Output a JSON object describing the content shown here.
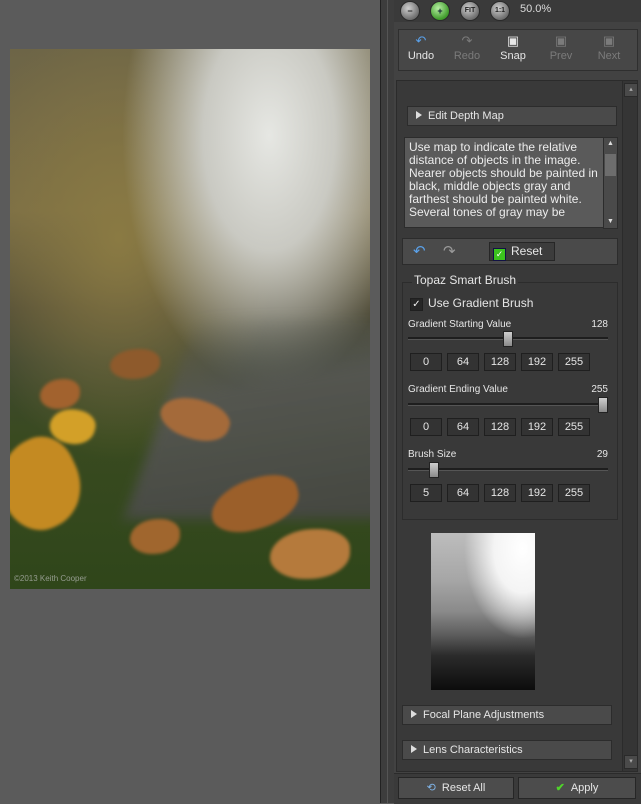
{
  "zoom": {
    "level": "50.0%",
    "buttons": [
      "minus-icon",
      "plus-icon",
      "fit",
      "1:1"
    ],
    "fit_label": "FIT",
    "actual_label": "1:1"
  },
  "toolbar": {
    "undo": "Undo",
    "redo": "Redo",
    "snap": "Snap",
    "prev": "Prev",
    "next": "Next"
  },
  "sections": {
    "edit_depth_map": "Edit Depth Map",
    "focal_plane": "Focal Plane Adjustments",
    "lens": "Lens Characteristics"
  },
  "description": "Use map to indicate the relative distance of objects in the image. Nearer objects should be painted in black, middle objects gray and farthest should be painted white. Several tones of gray may be",
  "mini_tools": {
    "reset": "Reset"
  },
  "smart_brush": {
    "title": "Topaz Smart Brush",
    "use_gradient": "Use Gradient Brush",
    "use_gradient_checked": true,
    "sliders": [
      {
        "label": "Gradient Starting Value",
        "value": "128",
        "fraction": 0.502
      },
      {
        "label": "Gradient Ending Value",
        "value": "255",
        "fraction": 1.0
      },
      {
        "label": "Brush Size",
        "value": "29",
        "fraction": 0.11
      }
    ],
    "presets_gradient": [
      "0",
      "64",
      "128",
      "192",
      "255"
    ],
    "presets_size": [
      "5",
      "64",
      "128",
      "192",
      "255"
    ]
  },
  "footer": {
    "reset_all": "Reset All",
    "apply": "Apply"
  },
  "photo": {
    "copyright": "©2013 Keith Cooper"
  },
  "colors": {
    "panel": "#424242",
    "accent_green": "#3bc21d"
  }
}
